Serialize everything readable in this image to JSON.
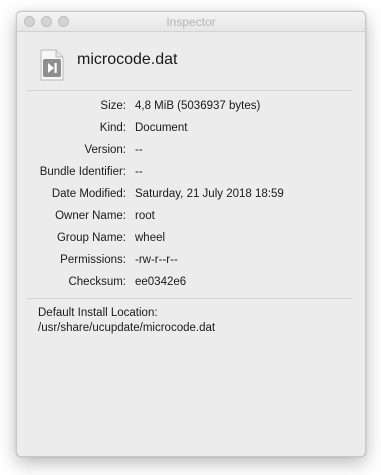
{
  "window": {
    "title": "Inspector"
  },
  "file": {
    "name": "microcode.dat",
    "icon": "document-file-icon"
  },
  "info": [
    {
      "label": "Size:",
      "value": "4,8 MiB (5036937 bytes)"
    },
    {
      "label": "Kind:",
      "value": "Document"
    },
    {
      "label": "Version:",
      "value": "--"
    },
    {
      "label": "Bundle Identifier:",
      "value": "--"
    },
    {
      "label": "Date Modified:",
      "value": "Saturday, 21 July 2018 18:59"
    },
    {
      "label": "Owner Name:",
      "value": "root"
    },
    {
      "label": "Group Name:",
      "value": "wheel"
    },
    {
      "label": "Permissions:",
      "value": "-rw-r--r--"
    },
    {
      "label": "Checksum:",
      "value": "ee0342e6"
    }
  ],
  "install": {
    "label": "Default Install Location:",
    "path": "/usr/share/ucupdate/microcode.dat"
  }
}
